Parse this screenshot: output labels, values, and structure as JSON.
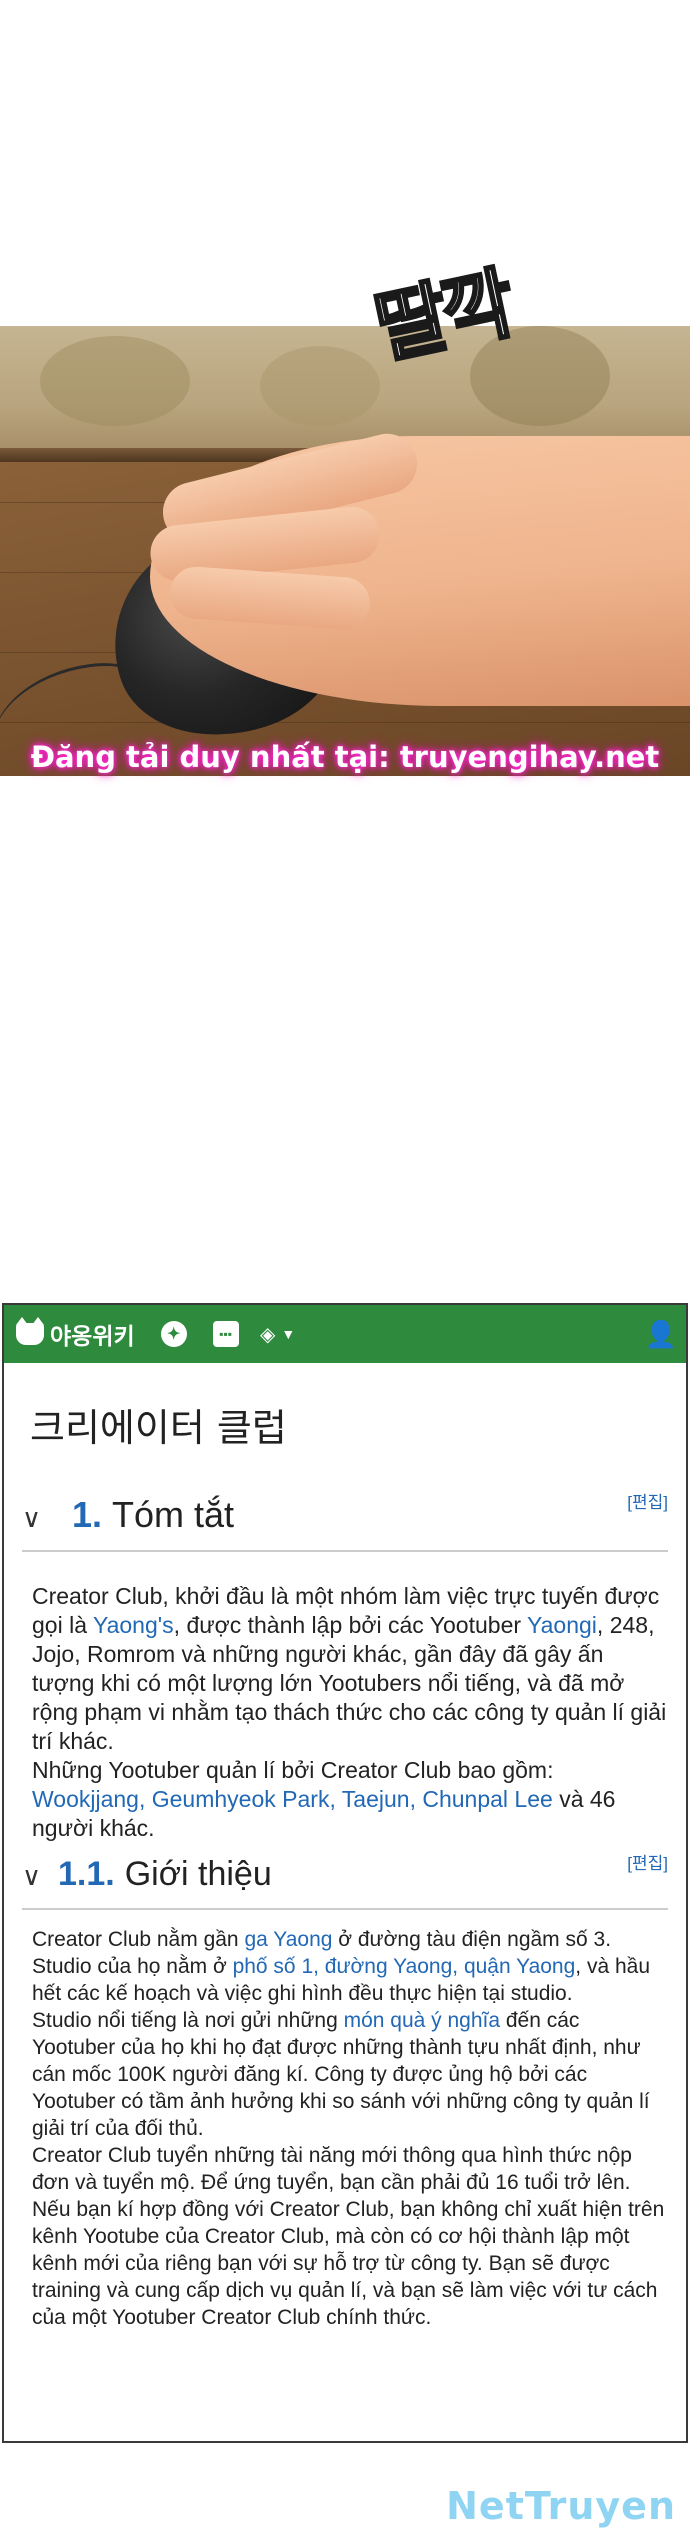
{
  "comic": {
    "sfx": "딸깍",
    "watermark": "Đăng tải duy nhất tại: truyengihay.net"
  },
  "wiki": {
    "site_name": "야옹위키",
    "icons": [
      "compass-icon",
      "chat-icon",
      "cube-icon",
      "caret-down-icon",
      "user-icon"
    ],
    "page_title": "크리에이터 클럽",
    "edit_label": "[편집]",
    "section1": {
      "number": "1.",
      "title": "Tóm tắt",
      "p1_a": "Creator Club, khởi đầu là một nhóm làm việc trực tuyến được gọi là ",
      "p1_link1": "Yaong's",
      "p1_b": ", được thành lập bởi các Yootuber ",
      "p1_link2": "Yaongi",
      "p1_c": ", 248, Jojo, Romrom và những người khác, gần đây đã gây ấn tượng khi có một lượng lớn Yootubers nổi tiếng, và đã mở rộng phạm vi nhằm tạo thách thức cho các công ty quản lí giải trí khác.",
      "p2_a": "Những Yootuber quản lí bởi Creator Club bao gồm: ",
      "p2_link": "Wookjjang, Geumhyeok Park, Taejun, Chunpal Lee",
      "p2_b": " và 46 người khác."
    },
    "section11": {
      "number": "1.1.",
      "title": "Giới thiệu",
      "p1_a": "Creator Club nằm gần ",
      "p1_link1": "ga Yaong",
      "p1_b": " ở đường tàu điện ngầm số 3. Studio của họ nằm ở ",
      "p1_link2": "phố số 1, đường Yaong, quận Yaong",
      "p1_c": ", và hầu hết các kế hoạch và việc ghi hình đều thực hiện tại studio.",
      "p2_a": "Studio nổi tiếng là nơi gửi những ",
      "p2_link": "món quà ý nghĩa",
      "p2_b": " đến các Yootuber của họ khi họ đạt được những thành tựu nhất định, như cán mốc 100K người đăng kí. Công ty được ủng hộ bởi các Yootuber có tầm ảnh hưởng khi so sánh với những công ty quản lí giải trí của đối thủ.",
      "p3": "Creator Club tuyển những tài năng mới thông qua hình thức nộp đơn và tuyển mộ. Để ứng tuyển, bạn cần phải đủ 16 tuổi trở lên. Nếu bạn kí hợp đồng với Creator Club, bạn không chỉ xuất hiện trên kênh Yootube của Creator Club, mà còn có cơ hội thành lập một kênh mới của riêng bạn với sự hỗ trợ từ công ty. Bạn sẽ được training và cung cấp dịch vụ quản lí, và bạn sẽ làm việc với tư cách của một Yootuber Creator Club chính thức."
    }
  },
  "footer_watermark": "NetTruyen",
  "colors": {
    "wiki_green": "#2e8a3c",
    "link_blue": "#2268b5",
    "watermark_pink": "#ff2ad4",
    "footer_blue": "#8fd4f2"
  }
}
